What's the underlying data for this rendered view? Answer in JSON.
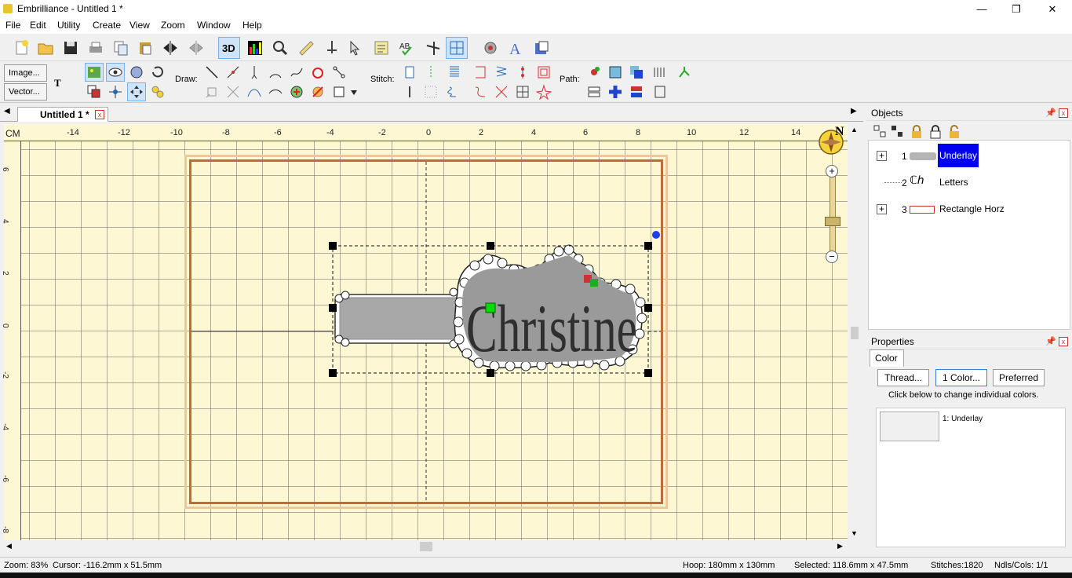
{
  "window": {
    "title": "Embrilliance - Untitled 1 *",
    "minimize": "—",
    "maximize": "❐",
    "close": "✕"
  },
  "menu": [
    "File",
    "Edit",
    "Utility",
    "Create",
    "View",
    "Zoom",
    "Window",
    "Help"
  ],
  "toolbar2": {
    "image_button": "Image...",
    "vector_button": "Vector...",
    "draw_label": "Draw:",
    "stitch_label": "Stitch:",
    "path_label": "Path:"
  },
  "document": {
    "tab_label": "Untitled 1 *",
    "tab_close": "x",
    "ruler_unit": "CM",
    "h_ticks": [
      "-14",
      "-12",
      "-10",
      "-8",
      "-6",
      "-4",
      "-2",
      "0",
      "2",
      "4",
      "6",
      "8",
      "10",
      "12",
      "14"
    ],
    "v_ticks": [
      "6",
      "4",
      "2",
      "0",
      "-2",
      "-4",
      "-6",
      "-8"
    ],
    "design_text": "Christine",
    "compass_label": "N"
  },
  "objects_panel": {
    "title": "Objects",
    "items": [
      {
        "number": "1",
        "name": "Underlay",
        "selected": true,
        "expandable": true
      },
      {
        "number": "2",
        "name": "Letters",
        "selected": false,
        "expandable": false
      },
      {
        "number": "3",
        "name": "Rectangle Horz",
        "selected": false,
        "expandable": true
      }
    ]
  },
  "properties_panel": {
    "title": "Properties",
    "tab": "Color",
    "thread_button": "Thread...",
    "color_button": "1 Color...",
    "preferred_button": "Preferred",
    "hint": "Click below to change individual colors.",
    "color_entries": [
      {
        "label": "1: Underlay",
        "swatch": "#f0f0f0"
      }
    ]
  },
  "status": {
    "zoom": "Zoom: 83%",
    "cursor": "Cursor: -116.2mm x 51.5mm",
    "hoop": "Hoop: 180mm x 130mm",
    "selected": "Selected: 118.6mm x 47.5mm",
    "stitches": "Stitches:1820",
    "ndls": "Ndls/Cols: 1/1"
  },
  "colors": {
    "canvas": "#fdf7d4",
    "hoop_outer": "#f2c59a",
    "hoop_inner": "#c06a3c",
    "selection": "#0000ee",
    "anchor": "#00dd00"
  }
}
